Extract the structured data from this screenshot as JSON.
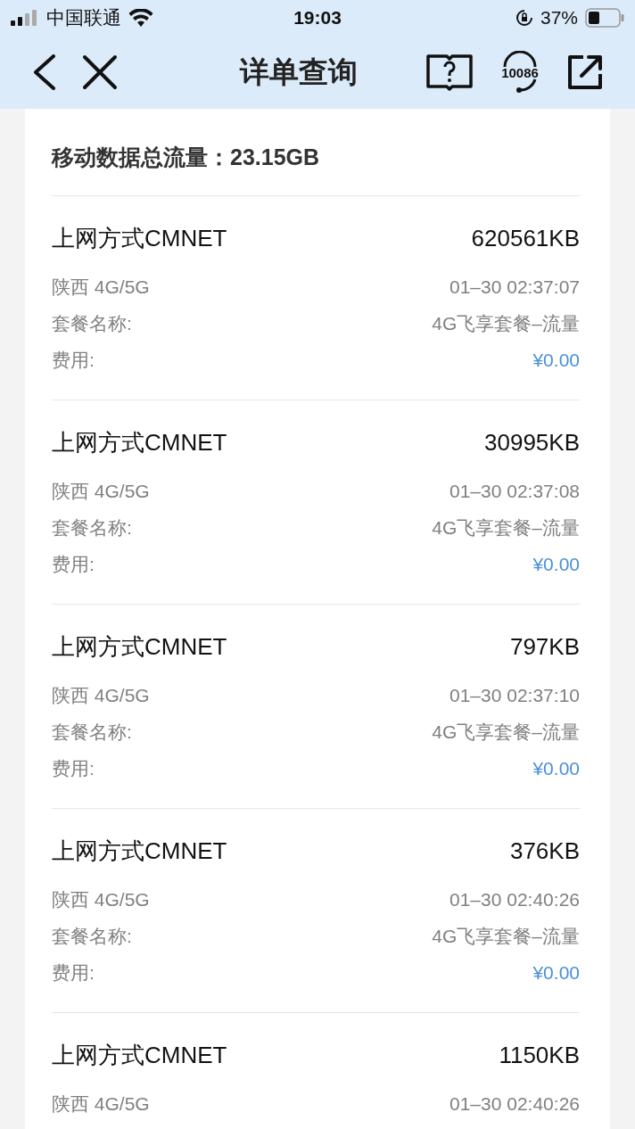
{
  "status_bar": {
    "carrier": "中国联通",
    "time": "19:03",
    "battery": "37%"
  },
  "nav": {
    "title": "详单查询",
    "service_number": "10086"
  },
  "summary": {
    "label": "移动数据总流量：",
    "value": "23.15GB"
  },
  "records": [
    {
      "title": "上网方式CMNET",
      "amount": "620561KB",
      "location": "陕西 4G/5G",
      "time": "01–30 02:37:07",
      "plan_label": "套餐名称:",
      "plan": "4G飞享套餐–流量",
      "fee_label": "费用:",
      "fee": "¥0.00"
    },
    {
      "title": "上网方式CMNET",
      "amount": "30995KB",
      "location": "陕西 4G/5G",
      "time": "01–30 02:37:08",
      "plan_label": "套餐名称:",
      "plan": "4G飞享套餐–流量",
      "fee_label": "费用:",
      "fee": "¥0.00"
    },
    {
      "title": "上网方式CMNET",
      "amount": "797KB",
      "location": "陕西 4G/5G",
      "time": "01–30 02:37:10",
      "plan_label": "套餐名称:",
      "plan": "4G飞享套餐–流量",
      "fee_label": "费用:",
      "fee": "¥0.00"
    },
    {
      "title": "上网方式CMNET",
      "amount": "376KB",
      "location": "陕西 4G/5G",
      "time": "01–30 02:40:26",
      "plan_label": "套餐名称:",
      "plan": "4G飞享套餐–流量",
      "fee_label": "费用:",
      "fee": "¥0.00"
    },
    {
      "title": "上网方式CMNET",
      "amount": "1150KB",
      "location": "陕西 4G/5G",
      "time": "01–30 02:40:26"
    }
  ]
}
